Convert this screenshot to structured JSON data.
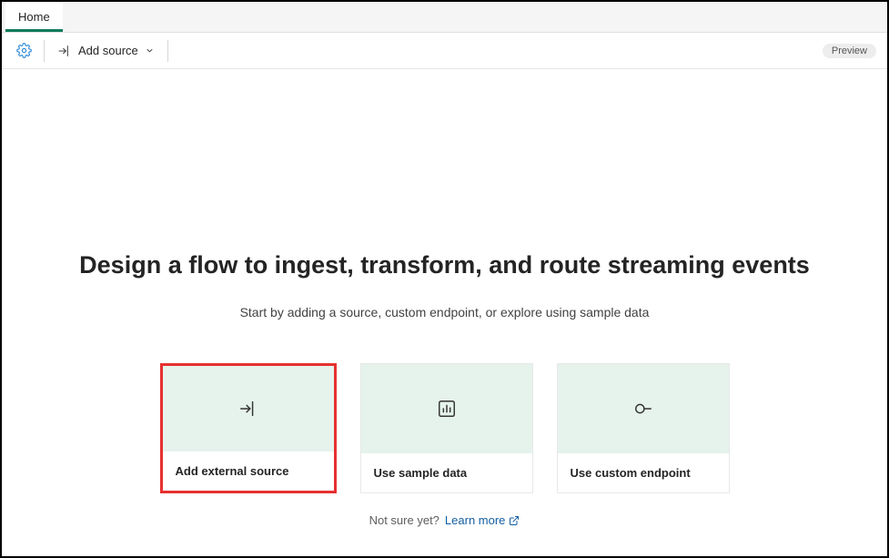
{
  "tabs": {
    "home": "Home"
  },
  "toolbar": {
    "addSource": "Add source",
    "previewBadge": "Preview"
  },
  "main": {
    "title": "Design a flow to ingest, transform, and route streaming events",
    "subtitle": "Start by adding a source, custom endpoint, or explore using sample data"
  },
  "cards": {
    "external": "Add external source",
    "sample": "Use sample data",
    "custom": "Use custom endpoint"
  },
  "footer": {
    "prefix": "Not sure yet?",
    "link": "Learn more"
  }
}
